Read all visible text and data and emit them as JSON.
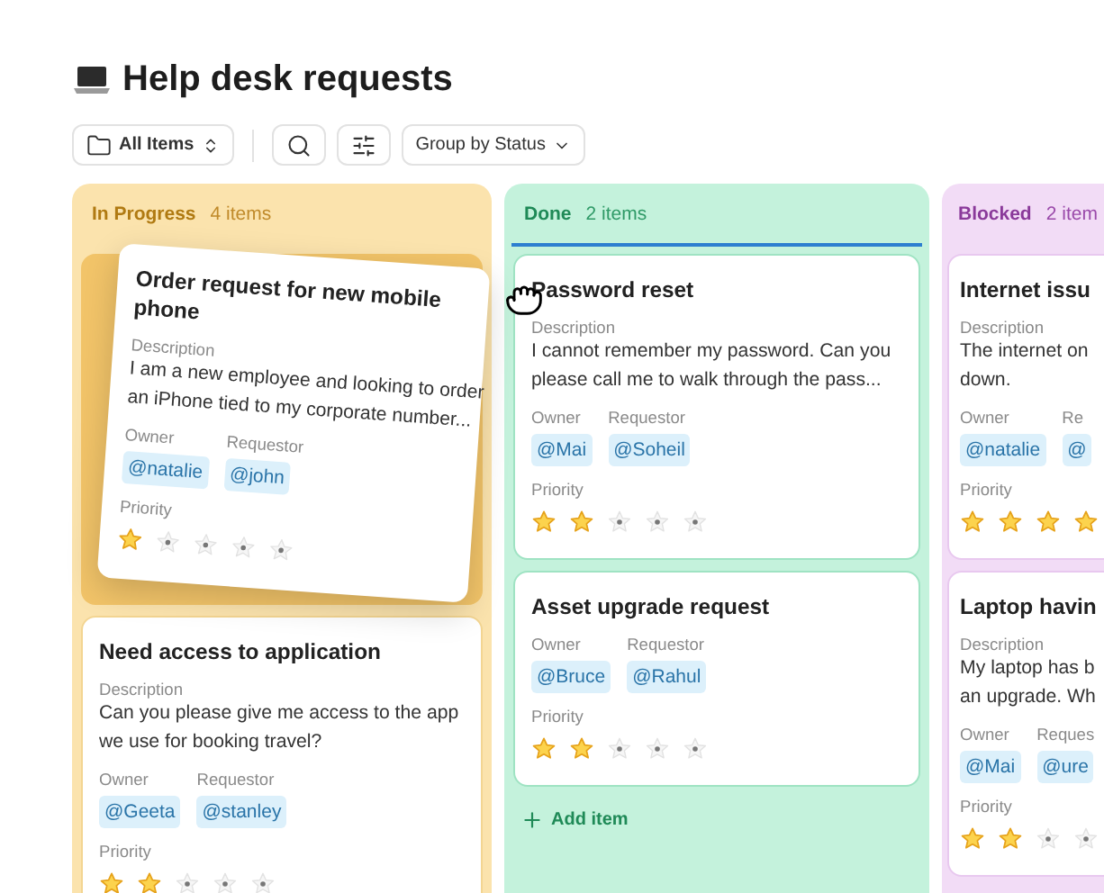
{
  "page": {
    "title": "Help desk requests"
  },
  "toolbar": {
    "view_selector": "All Items",
    "group_by": "Group by Status"
  },
  "columns": [
    {
      "kind": "in_progress",
      "name": "In Progress",
      "count": "4 items",
      "drop_target": false,
      "dragged_card": {
        "title": "Order request for new mobile phone",
        "description_label": "Description",
        "description": [
          "I am a new employee and looking to order",
          "an iPhone tied to my corporate number..."
        ],
        "owner_label": "Owner",
        "owner": "@natalie",
        "requestor_label": "Requestor",
        "requestor": "@john",
        "priority_label": "Priority",
        "stars": 1
      },
      "cards": [
        {
          "title": "Need access to application",
          "description_label": "Description",
          "description": [
            "Can you please give me access to the app",
            "we use for booking travel?"
          ],
          "owner_label": "Owner",
          "owner": "@Geeta",
          "requestor_label": "Requestor",
          "requestor": "@stanley",
          "priority_label": "Priority",
          "stars": 2
        }
      ]
    },
    {
      "kind": "done",
      "name": "Done",
      "count": "2 items",
      "drop_target": true,
      "cards": [
        {
          "title": "Password reset",
          "description_label": "Description",
          "description": [
            "I cannot remember my password. Can you",
            "please call me to walk through the pass..."
          ],
          "owner_label": "Owner",
          "owner": "@Mai",
          "requestor_label": "Requestor",
          "requestor": "@Soheil",
          "priority_label": "Priority",
          "stars": 2
        },
        {
          "title": "Asset upgrade request",
          "owner_label": "Owner",
          "owner": "@Bruce",
          "requestor_label": "Requestor",
          "requestor": "@Rahul",
          "priority_label": "Priority",
          "stars": 2
        }
      ],
      "add_item": "Add item"
    },
    {
      "kind": "blocked",
      "name": "Blocked",
      "count": "2 item",
      "drop_target": false,
      "cards": [
        {
          "title": "Internet issu",
          "description_label": "Description",
          "description": [
            "The internet on",
            "down."
          ],
          "owner_label": "Owner",
          "owner": "@natalie",
          "requestor_label": "Re",
          "requestor": "@",
          "priority_label": "Priority",
          "stars": 4
        },
        {
          "title": "Laptop havin",
          "description_label": "Description",
          "description": [
            "My laptop has b",
            "an upgrade. Wh"
          ],
          "owner_label": "Owner",
          "owner": "@Mai",
          "requestor_label": "Reques",
          "requestor": "@ure",
          "priority_label": "Priority",
          "stars": 2
        }
      ]
    }
  ]
}
